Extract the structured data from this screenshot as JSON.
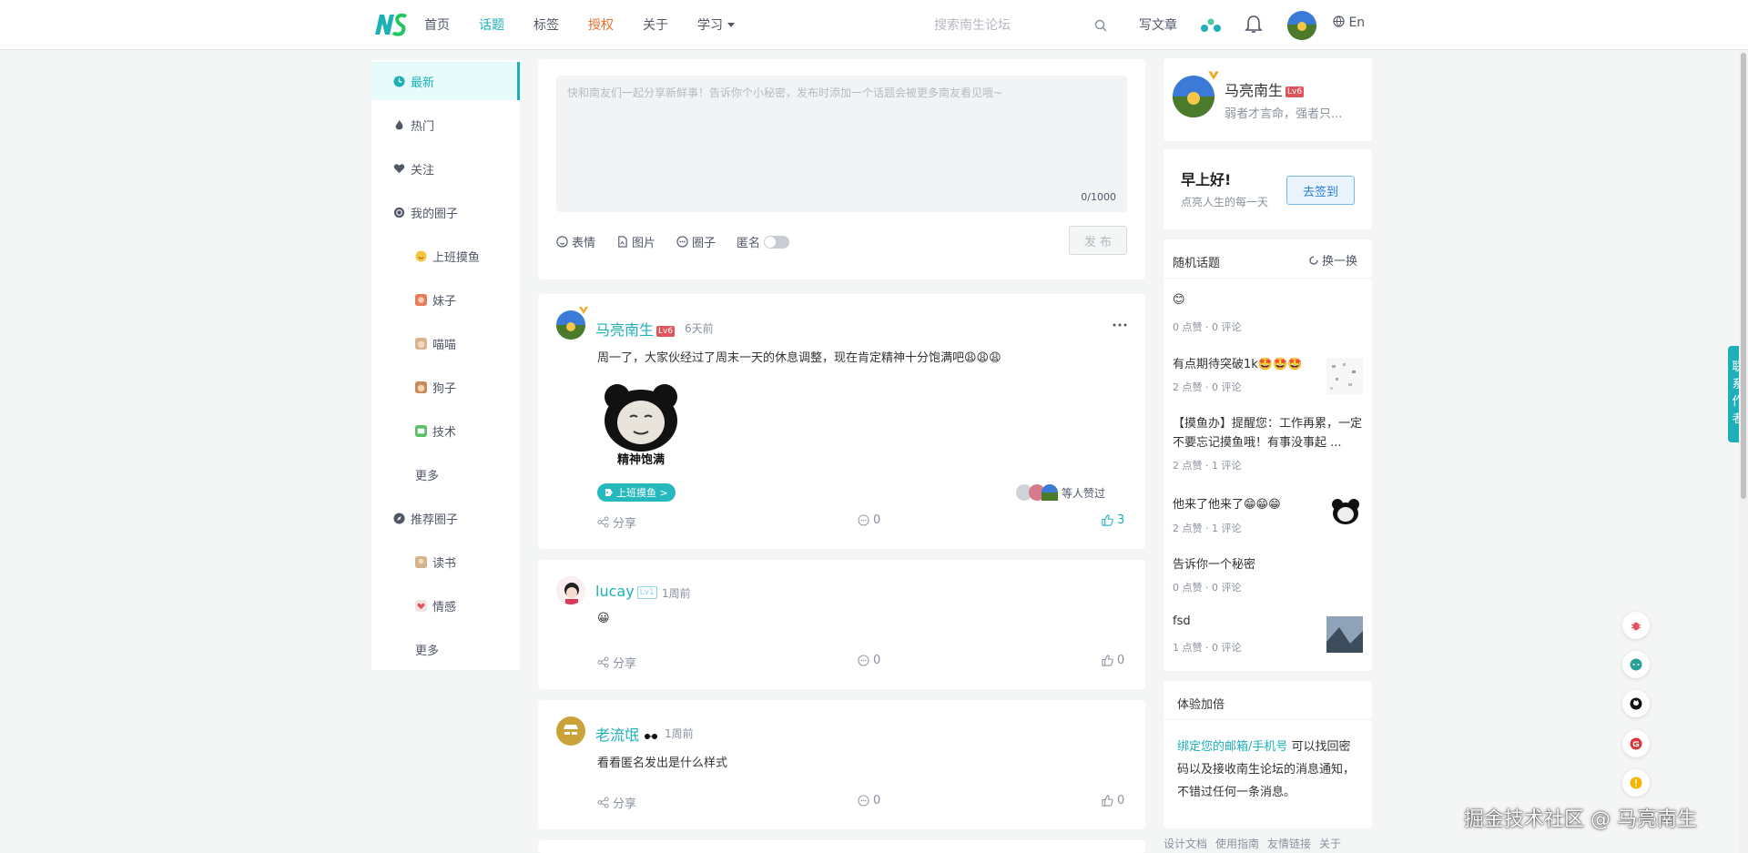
{
  "nav": {
    "items": [
      {
        "label": "首页"
      },
      {
        "label": "话题"
      },
      {
        "label": "标签"
      },
      {
        "label": "授权"
      },
      {
        "label": "关于"
      },
      {
        "label": "学习"
      }
    ],
    "search_placeholder": "搜索南生论坛",
    "write_label": "写文章",
    "lang_label": "En",
    "colors": {
      "accent": "#1db0b8",
      "highlight": "#e7702b"
    }
  },
  "sidebar": {
    "items": [
      {
        "label": "最新",
        "icon": "clock-icon"
      },
      {
        "label": "热门",
        "icon": "fire-icon"
      },
      {
        "label": "关注",
        "icon": "heart-icon"
      },
      {
        "label": "我的圈子",
        "icon": "circle-icon"
      },
      {
        "label": "上班摸鱼",
        "icon": "fish-emoji-icon"
      },
      {
        "label": "妹子",
        "icon": "girl-emoji-icon"
      },
      {
        "label": "喵喵",
        "icon": "cat-emoji-icon"
      },
      {
        "label": "狗子",
        "icon": "dog-emoji-icon"
      },
      {
        "label": "技术",
        "icon": "tech-emoji-icon"
      },
      {
        "label": "更多",
        "icon": ""
      },
      {
        "label": "推荐圈子",
        "icon": "compass-icon"
      },
      {
        "label": "读书",
        "icon": "book-emoji-icon"
      },
      {
        "label": "情感",
        "icon": "love-emoji-icon"
      },
      {
        "label": "更多",
        "icon": ""
      }
    ]
  },
  "compose": {
    "placeholder": "快和南友们一起分享新鲜事！告诉你个小秘密，发布时添加一个话题会被更多南友看见哦~",
    "counter": "0/1000",
    "tools": [
      {
        "label": "表情"
      },
      {
        "label": "图片"
      },
      {
        "label": "圈子"
      },
      {
        "label": "匿名"
      }
    ],
    "publish_label": "发 布"
  },
  "posts": [
    {
      "author": "马亮南生",
      "level": "Lv6",
      "time": "6天前",
      "content": "周一了，大家伙经过了周末一天的休息调整，现在肯定精神十分饱满吧😩😩😩",
      "image_caption": "精神饱满",
      "tag": "上班摸鱼 >",
      "likers_text": "等人赞过",
      "share_label": "分享",
      "comments": "0",
      "likes": "3"
    },
    {
      "author": "lucay",
      "level": "Lv1",
      "time": "1周前",
      "content": "😀",
      "share_label": "分享",
      "comments": "0",
      "likes": "0"
    },
    {
      "author": "老流氓",
      "level": "",
      "time": "1周前",
      "content": "看看匿名发出是什么样式",
      "share_label": "分享",
      "comments": "0",
      "likes": "0"
    }
  ],
  "profile": {
    "name": "马亮南生",
    "level": "Lv6",
    "bio": "弱者才言命，强者只..."
  },
  "greeting": {
    "title": "早上好!",
    "subtitle": "点亮人生的每一天",
    "checkin_label": "去签到"
  },
  "random_topics": {
    "title": "随机话题",
    "refresh_label": "换一换",
    "items": [
      {
        "title": "😊",
        "meta": "0 点赞 · 0 评论"
      },
      {
        "title": "有点期待突破1k🤩🤩🤩",
        "meta": "2 点赞 · 0 评论"
      },
      {
        "title": "【摸鱼办】提醒您：工作再累，一定不要忘记摸鱼哦！有事没事起 ...",
        "meta": "2 点赞 · 1 评论"
      },
      {
        "title": "他来了他来了😁😁😁",
        "meta": "2 点赞 · 1 评论"
      },
      {
        "title": "告诉你一个秘密",
        "meta": "0 点赞 · 0 评论"
      },
      {
        "title": "fsd",
        "meta": "1 点赞 · 0 评论"
      }
    ]
  },
  "experience": {
    "title": "体验加倍",
    "link_text": "绑定您的邮箱/手机号",
    "text": "可以找回密码以及接收南生论坛的消息通知，不错过任何一条消息。"
  },
  "footer_links": [
    "设计文档",
    "使用指南",
    "友情链接",
    "关于"
  ],
  "contact_tab": "联系作者",
  "watermark": "掘金技术社区 @ 马亮南生"
}
